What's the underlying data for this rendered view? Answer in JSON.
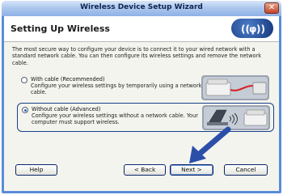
{
  "window": {
    "title": "Wireless Device Setup Wizard",
    "close_glyph": "✕"
  },
  "header": {
    "title": "Setting Up Wireless"
  },
  "intro": {
    "text": "The most secure way to configure your device is to connect it to your wired network with a standard network cable. You can then configure its wireless settings and remove the network cable."
  },
  "options": [
    {
      "label": "With cable (Recommended)",
      "description": "Configure your wireless settings by temporarily using a network cable.",
      "selected": false
    },
    {
      "label": "Without cable (Advanced)",
      "description": "Configure your wireless settings without a network cable. Your computer must support wireless.",
      "selected": true
    }
  ],
  "buttons": {
    "help": "Help",
    "back": "< Back",
    "next": "Next >",
    "cancel": "Cancel"
  },
  "colors": {
    "accent": "#2f5fb6",
    "frame": "#5a8cd8",
    "arrow": "#2b4fa8"
  }
}
